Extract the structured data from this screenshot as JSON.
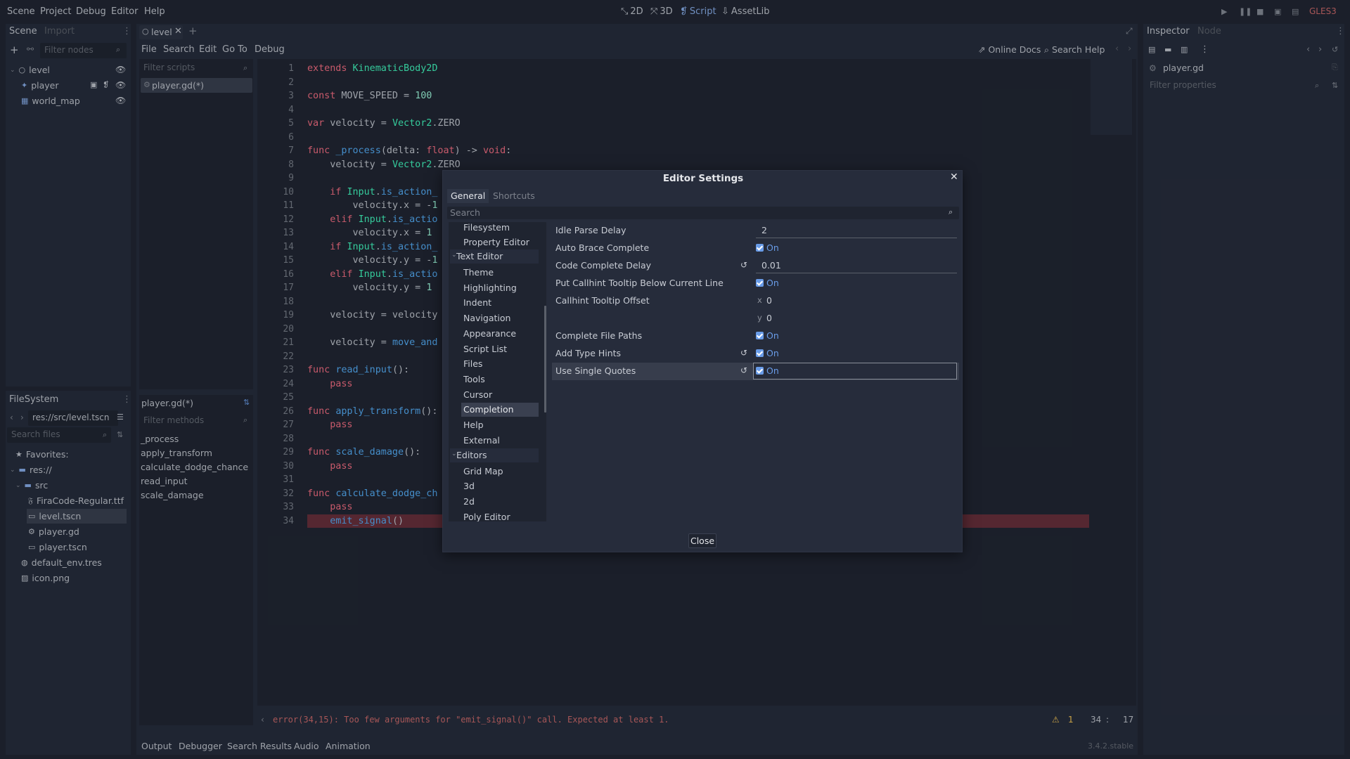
{
  "menubar": {
    "items": [
      "Scene",
      "Project",
      "Debug",
      "Editor",
      "Help"
    ],
    "modes": [
      "2D",
      "3D",
      "Script",
      "AssetLib"
    ],
    "renderer": "GLES3"
  },
  "scene_dock": {
    "tabs": [
      "Scene",
      "Import"
    ],
    "filter_placeholder": "Filter nodes",
    "nodes": [
      "level",
      "player",
      "world_map"
    ]
  },
  "filesystem_dock": {
    "title": "FileSystem",
    "path": "res://src/level.tscn",
    "search_placeholder": "Search files",
    "items": [
      "Favorites:",
      "res://",
      "src",
      "FiraCode-Regular.ttf",
      "level.tscn",
      "player.gd",
      "player.tscn",
      "default_env.tres",
      "icon.png"
    ]
  },
  "editor": {
    "tab": "level",
    "menu": [
      "File",
      "Search",
      "Edit",
      "Go To",
      "Debug"
    ],
    "online_docs": "Online Docs",
    "search_help": "Search Help",
    "filter_scripts": "Filter scripts",
    "script_item": "player.gd(*)",
    "methods_title": "player.gd(*)",
    "filter_methods": "Filter methods",
    "methods": [
      "_process",
      "apply_transform",
      "calculate_dodge_chance",
      "read_input",
      "scale_damage"
    ],
    "error": "error(34,15): Too few arguments for \"emit_signal()\" call. Expected at least 1.",
    "warnings": "1",
    "line": "34",
    "col": "17",
    "bottom_tabs": [
      "Output",
      "Debugger",
      "Search Results",
      "Audio",
      "Animation"
    ],
    "version": "3.4.2.stable"
  },
  "inspector": {
    "tabs": [
      "Inspector",
      "Node"
    ],
    "file": "player.gd",
    "filter_placeholder": "Filter properties"
  },
  "modal": {
    "title": "Editor Settings",
    "tabs": [
      "General",
      "Shortcuts"
    ],
    "search_placeholder": "Search",
    "close_label": "Close",
    "categories": [
      "Filesystem",
      "Property Editor",
      "Text Editor",
      "Theme",
      "Highlighting",
      "Indent",
      "Navigation",
      "Appearance",
      "Script List",
      "Files",
      "Tools",
      "Cursor",
      "Completion",
      "Help",
      "External",
      "Editors",
      "Grid Map",
      "3d",
      "2d",
      "Poly Editor"
    ],
    "settings": [
      {
        "label": "Idle Parse Delay",
        "value": "2"
      },
      {
        "label": "Auto Brace Complete",
        "value": "On"
      },
      {
        "label": "Code Complete Delay",
        "value": "0.01"
      },
      {
        "label": "Put Callhint Tooltip Below Current Line",
        "value": "On"
      },
      {
        "label": "Callhint Tooltip Offset",
        "x_label": "x",
        "x": "0",
        "y_label": "y",
        "y": "0"
      },
      {
        "label": "Complete File Paths",
        "value": "On"
      },
      {
        "label": "Add Type Hints",
        "value": "On"
      },
      {
        "label": "Use Single Quotes",
        "value": "On"
      }
    ]
  }
}
